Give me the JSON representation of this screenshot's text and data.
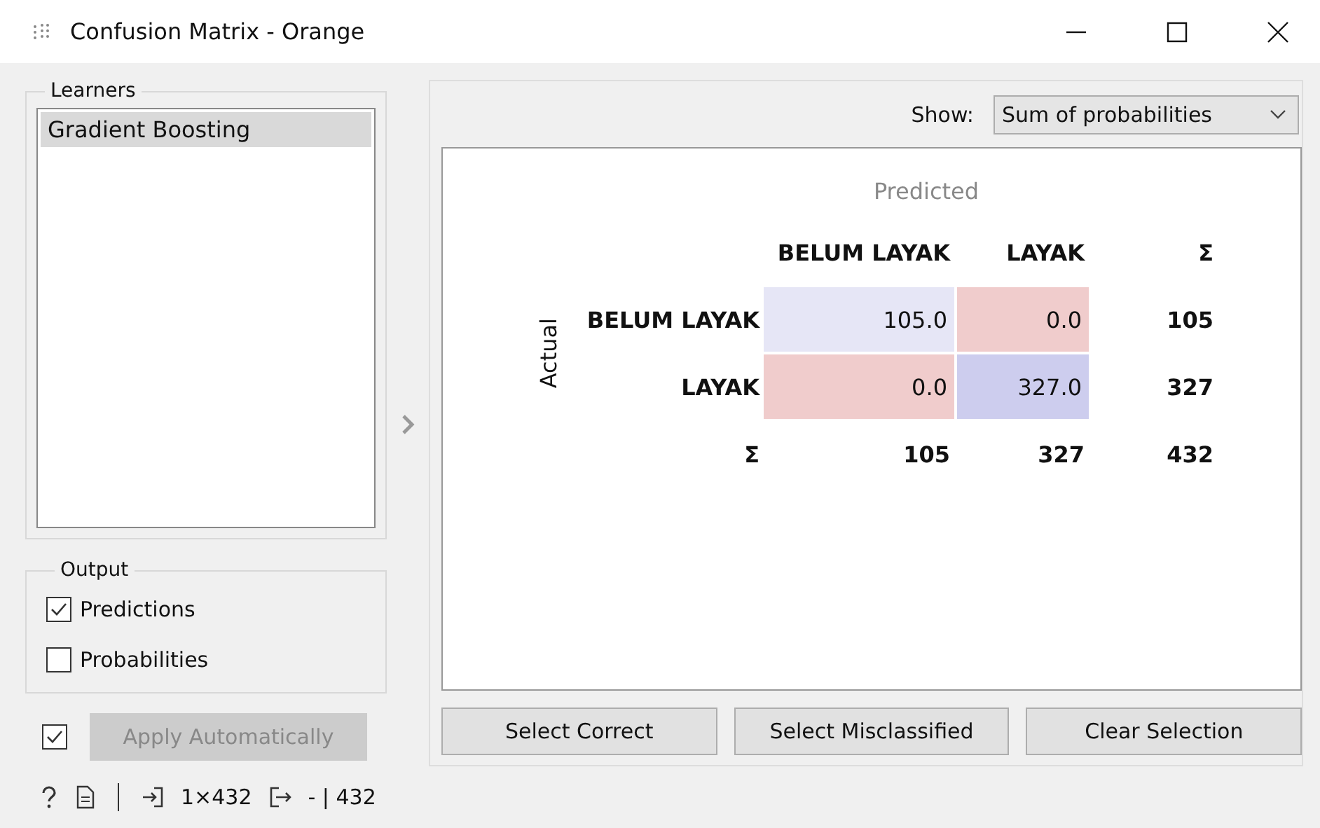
{
  "window": {
    "title": "Confusion Matrix - Orange"
  },
  "learners": {
    "title": "Learners",
    "items": [
      {
        "label": "Gradient Boosting",
        "selected": true
      }
    ]
  },
  "output": {
    "title": "Output",
    "options": [
      {
        "label": "Predictions",
        "checked": true
      },
      {
        "label": "Probabilities",
        "checked": false
      }
    ]
  },
  "apply": {
    "checked": true,
    "label": "Apply Automatically",
    "disabled": true
  },
  "show": {
    "label": "Show:",
    "value": "Sum of probabilities"
  },
  "matrix": {
    "predicted_label": "Predicted",
    "actual_label": "Actual",
    "columns": [
      "BELUM LAYAK",
      "LAYAK",
      "Σ"
    ],
    "rows": [
      {
        "label": "BELUM LAYAK",
        "cells": [
          {
            "value": "105.0",
            "color": "#e6e6f6"
          },
          {
            "value": "0.0",
            "color": "#f0cccc"
          }
        ],
        "total": "105"
      },
      {
        "label": "LAYAK",
        "cells": [
          {
            "value": "0.0",
            "color": "#f0cccc"
          },
          {
            "value": "327.0",
            "color": "#cdcdee"
          }
        ],
        "total": "327"
      }
    ],
    "totals": {
      "label": "Σ",
      "values": [
        "105",
        "327",
        "432"
      ]
    }
  },
  "buttons": [
    "Select Correct",
    "Select Misclassified",
    "Clear Selection"
  ],
  "status_bar": {
    "input": "1×432",
    "output": "- | 432"
  }
}
